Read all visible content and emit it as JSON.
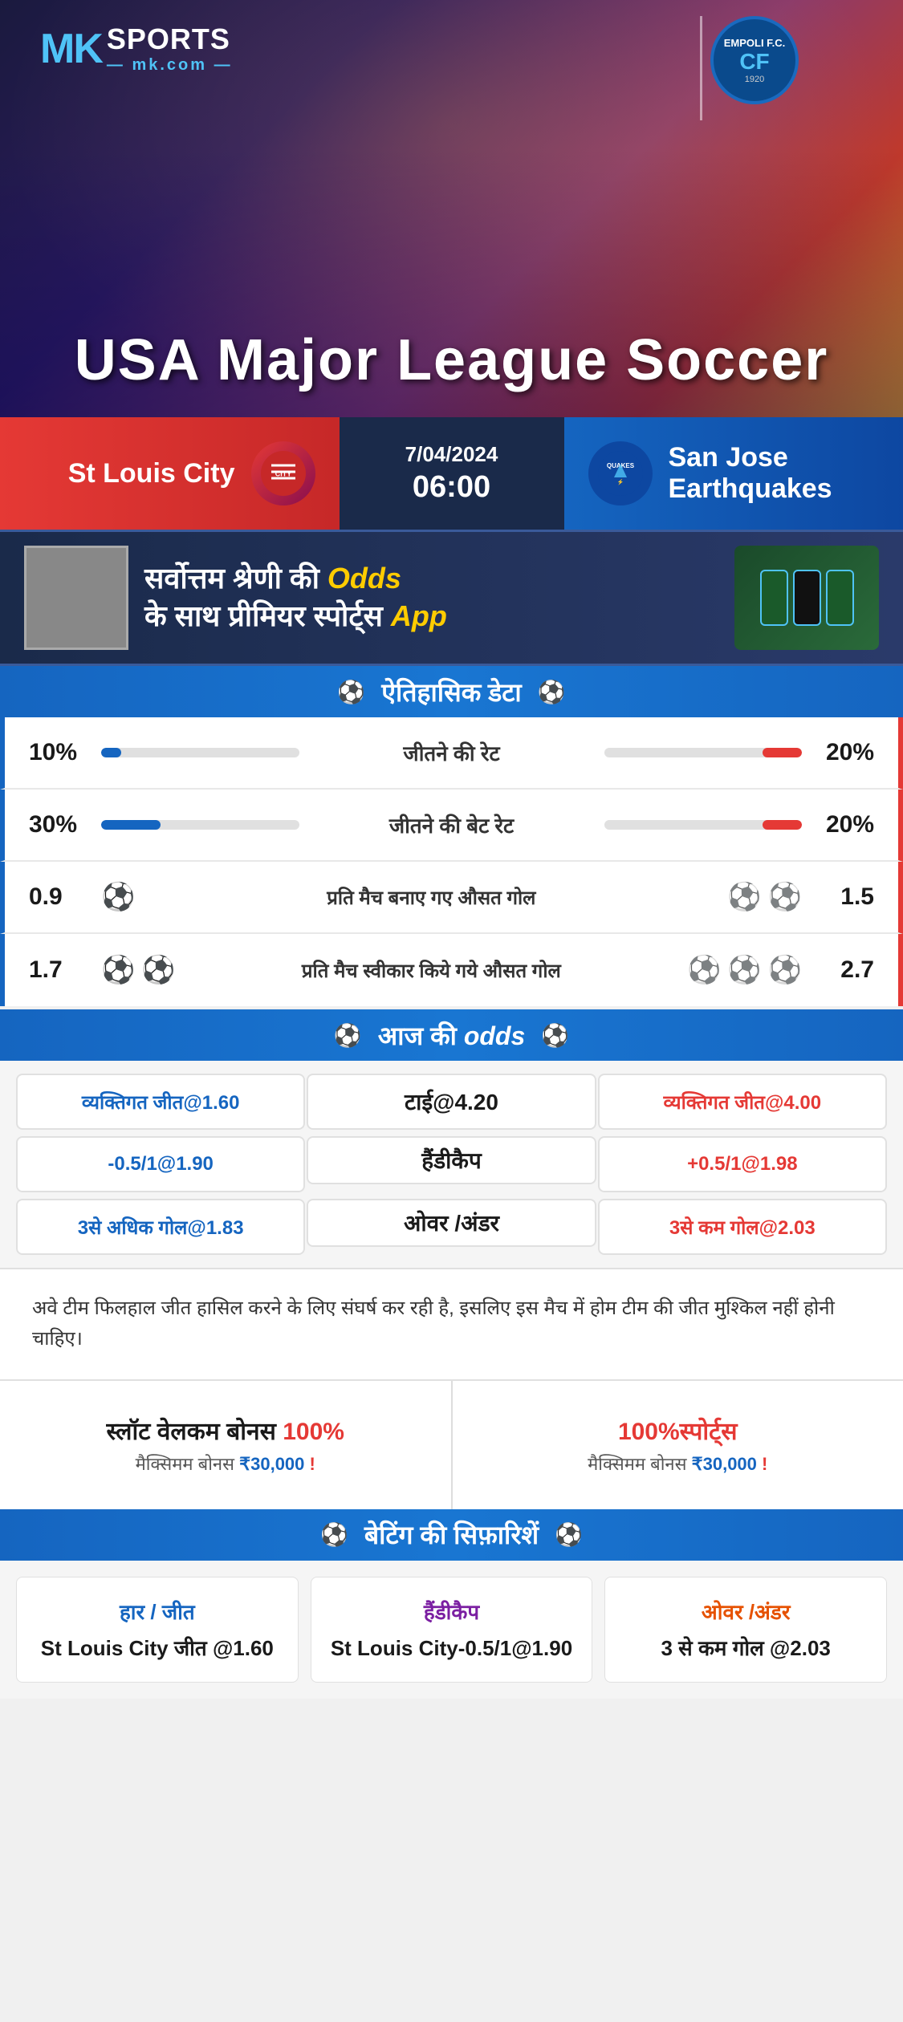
{
  "brand": {
    "mk_label": "MK",
    "sports_label": "SPORTS",
    "domain": "mk.com",
    "empoli_name": "EMPOLI F.C.",
    "empoli_cf": "CF",
    "empoli_year": "1920"
  },
  "hero": {
    "title": "USA Major League Soccer"
  },
  "match": {
    "team_left": "St Louis City",
    "team_right": "San Jose Earthquakes",
    "team_right_short": "QUAKES",
    "date": "7/04/2024",
    "time": "06:00"
  },
  "ad": {
    "text": "सर्वोत्तम श्रेणी की Odds के साथ प्रीमियर स्पोर्ट्स App",
    "text_highlight": "Odds",
    "text_app": "App"
  },
  "historical": {
    "section_title": "ऐतिहासिक डेटा",
    "rows": [
      {
        "label": "जीतने की रेट",
        "left_val": "10%",
        "right_val": "20%",
        "left_pct": 10,
        "right_pct": 20
      },
      {
        "label": "जीतने की बेट रेट",
        "left_val": "30%",
        "right_val": "20%",
        "left_pct": 30,
        "right_pct": 20
      }
    ],
    "goal_rows": [
      {
        "label": "प्रति मैच बनाए गए औसत गोल",
        "left_val": "0.9",
        "right_val": "1.5",
        "left_icons": 1,
        "right_icons": 2
      },
      {
        "label": "प्रति मैच स्वीकार किये गये औसत गोल",
        "left_val": "1.7",
        "right_val": "2.7",
        "left_icons": 2,
        "right_icons": 3
      }
    ]
  },
  "odds": {
    "section_title": "आज की odds",
    "rows": [
      {
        "left": "व्यक्तिगत जीत@1.60",
        "center": "टाई@4.20",
        "right": "व्यक्तिगत जीत@4.00"
      },
      {
        "left": "-0.5/1@1.90",
        "center_label": "हैंडीकैप",
        "right": "+0.5/1@1.98"
      },
      {
        "left": "3से अधिक गोल@1.83",
        "center_label": "ओवर /अंडर",
        "right": "3से कम गोल@2.03"
      }
    ]
  },
  "note": {
    "text": "अवे टीम फिलहाल जीत हासिल करने के लिए संघर्ष कर रही है, इसलिए इस मैच में होम टीम की जीत मुश्किल नहीं होनी चाहिए।"
  },
  "bonus": {
    "left_title": "स्लॉट वेलकम बोनस 100%",
    "left_sub": "मैक्सिमम बोनस ₹30,000 !",
    "right_title": "100%स्पोर्ट्स",
    "right_sub": "मैक्सिमम बोनस  ₹30,000 !"
  },
  "betting_rec": {
    "section_title": "बेटिंग की सिफ़ारिशें",
    "items": [
      {
        "type": "हार / जीत",
        "value": "St Louis City जीत @1.60",
        "type_color": "blue"
      },
      {
        "type": "हैंडीकैप",
        "value": "St Louis City-0.5/1@1.90",
        "type_color": "purple"
      },
      {
        "type": "ओवर /अंडर",
        "value": "3 से कम गोल @2.03",
        "type_color": "orange"
      }
    ]
  }
}
